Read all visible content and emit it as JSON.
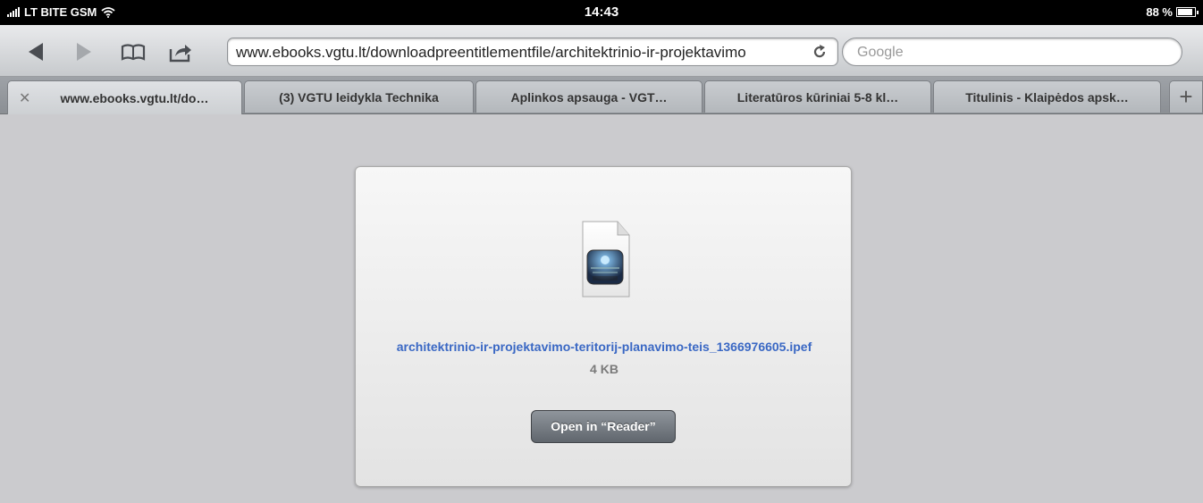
{
  "status_bar": {
    "carrier": "LT BITE GSM",
    "time": "14:43",
    "battery": "88 %"
  },
  "toolbar": {
    "url": "www.ebooks.vgtu.lt/downloadpreentitlementfile/architektrinio-ir-projektavimo",
    "search_placeholder": "Google"
  },
  "tabs": [
    {
      "label": "www.ebooks.vgtu.lt/do…",
      "active": true
    },
    {
      "label": "(3) VGTU leidykla Technika"
    },
    {
      "label": "Aplinkos apsauga - VGT…"
    },
    {
      "label": "Literatūros kūriniai 5-8 kl…"
    },
    {
      "label": "Titulinis - Klaipėdos apsk…"
    }
  ],
  "add_tab": "+",
  "download": {
    "filename": "architektrinio-ir-projektavimo-teritorij-planavimo-teis_1366976605.ipef",
    "size": "4 KB",
    "open_button": "Open in “Reader”",
    "icon_name": "ipublish-central-document-icon"
  },
  "colors": {
    "link_blue": "#3a68c4",
    "background": "#cbcbce"
  }
}
